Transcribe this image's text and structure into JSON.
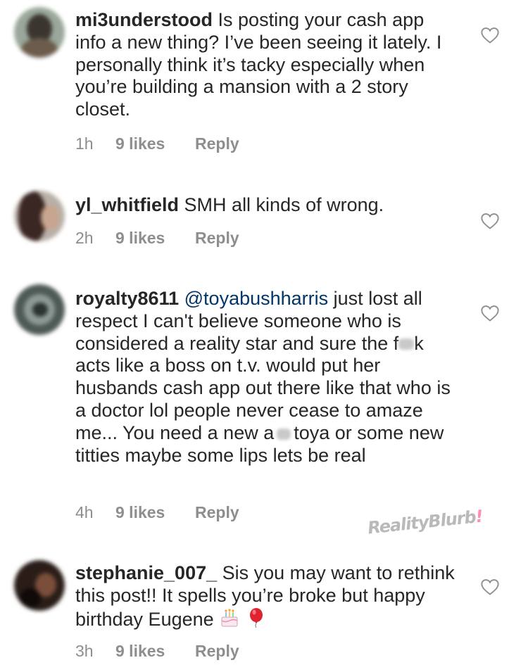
{
  "comments": [
    {
      "username": "mi3understood",
      "text": "Is posting your cash app info a new thing? I’ve been seeing it lately. I personally think it’s tacky especially when you’re building a mansion with a 2 story closet.",
      "time": "1h",
      "likes": "9 likes",
      "reply": "Reply"
    },
    {
      "username": "yl_whitfield",
      "text": "SMH all kinds of wrong.",
      "time": "2h",
      "likes": "9 likes",
      "reply": "Reply"
    },
    {
      "username": "royalty8611",
      "mention": "@toyabushharris",
      "text_1": "just lost all respect I can't believe someone who is considered a reality star and sure the f",
      "text_2": "k acts like a boss on t.v. would put her husbands cash app out there like that who is a doctor lol people never cease to amaze me... You need a new a",
      "text_3": "toya or some new titties maybe some lips lets be real",
      "time": "4h",
      "likes": "9 likes",
      "reply": "Reply"
    },
    {
      "username": "stephanie_007_",
      "text": "Sis you may want to rethink this post!! It spells you’re broke but happy birthday Eugene",
      "time": "3h",
      "likes": "9 likes",
      "reply": "Reply"
    }
  ],
  "watermark": {
    "brand": "RealityBlurb",
    "mark": "!"
  },
  "icons": {
    "like": "heart-outline-icon",
    "emoji_1": "birthday-cake-icon",
    "emoji_2": "red-balloon-icon"
  },
  "colors": {
    "text": "#262626",
    "meta": "#8e8e8e",
    "mention": "#003569",
    "balloon": "#e0242f"
  }
}
